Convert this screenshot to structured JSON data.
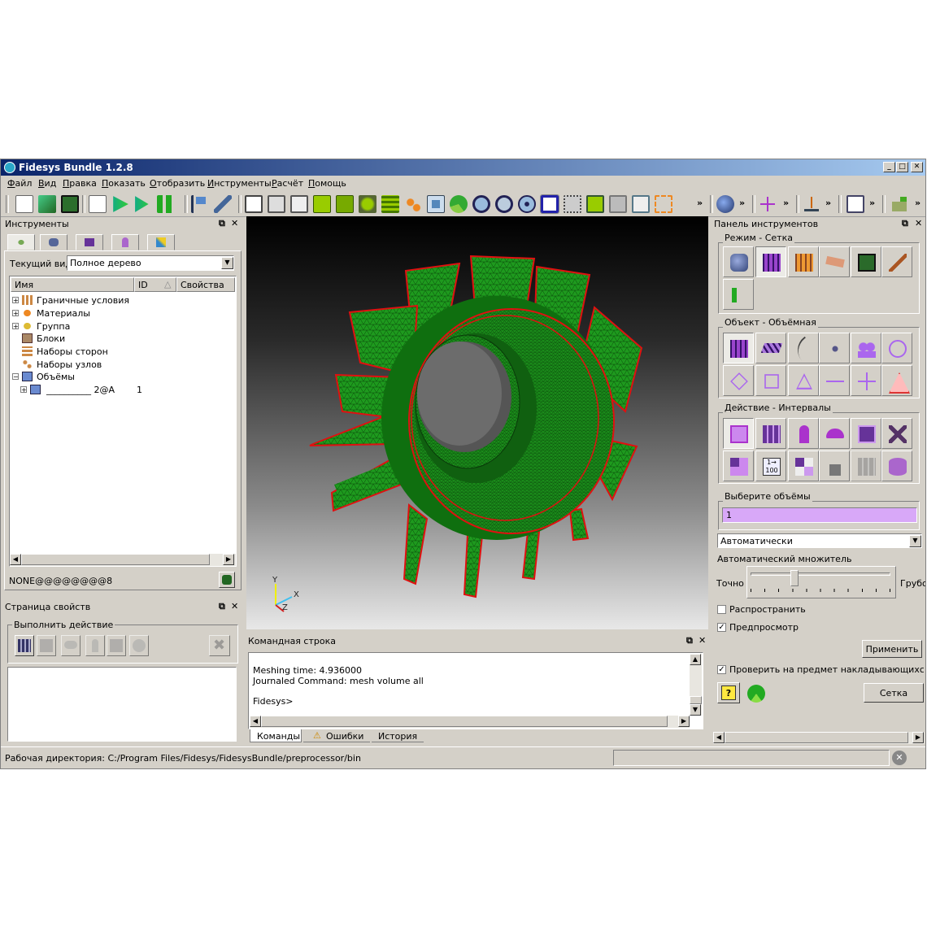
{
  "app": {
    "title": "Fidesys Bundle 1.2.8",
    "window_buttons": {
      "minimize": "_",
      "maximize": "□",
      "close": "✕"
    }
  },
  "menu": [
    "Файл",
    "Вид",
    "Правка",
    "Показать",
    "Отобразить",
    "Инструменты",
    "Расчёт",
    "Помощь"
  ],
  "toolbar": {
    "overflow": "»"
  },
  "left_panel": {
    "title": "Инструменты",
    "current_view_label": "Текущий вид",
    "current_view_value": "Полное дерево",
    "columns": [
      "Имя",
      "ID",
      "Свойства"
    ],
    "tree": [
      {
        "label": "Граничные условия",
        "expand": "+",
        "icon": "boundary-conditions-icon"
      },
      {
        "label": "Материалы",
        "expand": "+",
        "icon": "materials-icon"
      },
      {
        "label": "Группа",
        "expand": "+",
        "icon": "group-icon"
      },
      {
        "label": "Блоки",
        "expand": "",
        "icon": "blocks-icon"
      },
      {
        "label": "Наборы сторон",
        "expand": "",
        "icon": "sidesets-icon"
      },
      {
        "label": "Наборы узлов",
        "expand": "",
        "icon": "nodesets-icon"
      },
      {
        "label": "Объёмы",
        "expand": "−",
        "icon": "volumes-icon"
      },
      {
        "label": "__________ 2@A",
        "id": "1",
        "expand": "+",
        "icon": "volume-icon"
      }
    ],
    "status": "NONE@@@@@@@@8"
  },
  "properties_panel": {
    "title": "Страница свойств",
    "action_group": "Выполнить действие"
  },
  "viewport": {
    "axes": {
      "y": "Y",
      "x": "X",
      "z": "Z"
    }
  },
  "command_panel": {
    "title": "Командная строка",
    "lines": [
      "Meshing time: 4.936000",
      "Journaled Command: mesh volume all",
      "",
      "Fidesys>"
    ],
    "tabs": [
      "Команды",
      "Ошибки",
      "История"
    ]
  },
  "right_panel": {
    "title": "Панель инструментов",
    "mode_group": "Режим - Сетка",
    "object_group": "Объект - Объёмная",
    "action_group": "Действие - Интервалы",
    "select_label": "Выберите объёмы",
    "select_value": "1",
    "scheme_value": "Автоматически",
    "auto_factor_label": "Автоматический множитель",
    "fine_label": "Точно",
    "coarse_label": "Грубо",
    "slider_level": 0.3,
    "propagate_label": "Распространить",
    "propagate_checked": false,
    "preview_label": "Предпросмотр",
    "preview_checked": true,
    "apply_button": "Применить",
    "check_overlap_label": "Проверить на предмет накладывающихся пове",
    "check_overlap_checked": true,
    "mesh_button": "Сетка"
  },
  "statusbar": {
    "workdir": "Рабочая директория: C:/Program Files/Fidesys/FidesysBundle/preprocessor/bin"
  },
  "colors": {
    "mesh": "#1a9a1a",
    "edge": "#e01010",
    "selection": "#d8a8f8",
    "titlebar": "#0a246a"
  }
}
